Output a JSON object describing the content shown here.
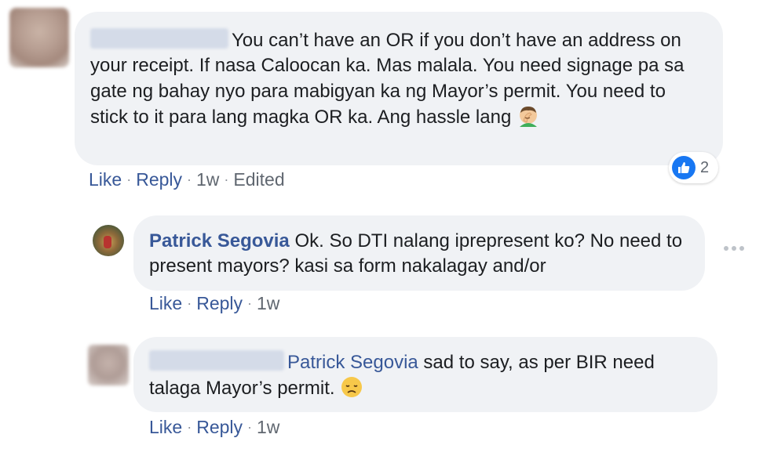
{
  "comments": [
    {
      "author": "",
      "text": "You can’t have an OR if you don’t have an address on your receipt. If nasa Caloocan ka. Mas malala. You need signage pa sa gate ng bahay nyo para mabigyan ka ng Mayor’s permit. You need to stick to it para lang magka OR ka. Ang hassle lang",
      "emoji": "face-palm-emoji",
      "actions": {
        "like": "Like",
        "reply": "Reply",
        "time": "1w",
        "edited": "Edited"
      },
      "reactions": {
        "icon": "thumbs-up-icon",
        "count": "2"
      }
    },
    {
      "author": "Patrick Segovia",
      "text": "Ok. So DTI nalang iprepresent ko? No need to present mayors? kasi sa form nakalagay and/or",
      "actions": {
        "like": "Like",
        "reply": "Reply",
        "time": "1w"
      },
      "more_icon": "more-options-icon"
    },
    {
      "author": "",
      "mention": "Patrick Segovia",
      "text": "sad to say, as per BIR need talaga Mayor’s permit.",
      "emoji": "disappointed-face-emoji",
      "actions": {
        "like": "Like",
        "reply": "Reply",
        "time": "1w"
      }
    }
  ],
  "colors": {
    "link": "#385898",
    "bubble": "#f0f2f5",
    "meta": "#606770",
    "like_blue": "#1877f2"
  }
}
